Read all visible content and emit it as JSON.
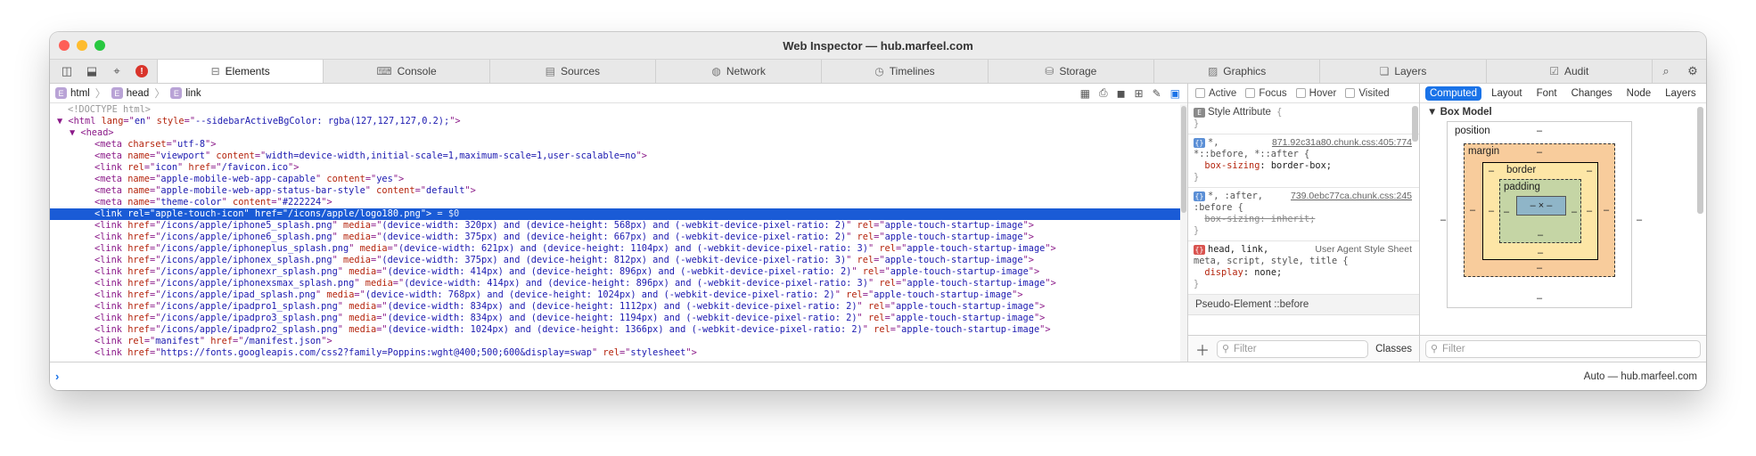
{
  "window": {
    "title": "Web Inspector — hub.marfeel.com"
  },
  "tabs": [
    {
      "label": "Elements",
      "icon": "elements-icon",
      "active": true
    },
    {
      "label": "Console",
      "icon": "console-icon"
    },
    {
      "label": "Sources",
      "icon": "document-icon"
    },
    {
      "label": "Network",
      "icon": "network-icon"
    },
    {
      "label": "Timelines",
      "icon": "clock-icon"
    },
    {
      "label": "Storage",
      "icon": "database-icon"
    },
    {
      "label": "Graphics",
      "icon": "image-icon"
    },
    {
      "label": "Layers",
      "icon": "layers-icon"
    },
    {
      "label": "Audit",
      "icon": "audit-icon"
    }
  ],
  "breadcrumb": [
    {
      "badge": "E",
      "label": "html"
    },
    {
      "badge": "E",
      "label": "head"
    },
    {
      "badge": "E",
      "label": "link"
    }
  ],
  "dom": {
    "doctype": "<!DOCTYPE html>",
    "html_line": [
      "▼ <",
      "html",
      " ",
      "lang",
      "=\"",
      "en",
      "\" ",
      "style",
      "=\"",
      "--sidebarActiveBgColor: rgba(127,127,127,0.2);",
      "\">"
    ],
    "head_line": "▼ <head>",
    "rows": [
      {
        "tag": "meta",
        "attrs": [
          [
            "charset",
            "utf-8"
          ]
        ]
      },
      {
        "tag": "meta",
        "attrs": [
          [
            "name",
            "viewport"
          ],
          [
            "content",
            "width=device-width,initial-scale=1,maximum-scale=1,user-scalable=no"
          ]
        ]
      },
      {
        "tag": "link",
        "attrs": [
          [
            "rel",
            "icon"
          ],
          [
            "href",
            "/favicon.ico"
          ]
        ]
      },
      {
        "tag": "meta",
        "attrs": [
          [
            "name",
            "apple-mobile-web-app-capable"
          ],
          [
            "content",
            "yes"
          ]
        ]
      },
      {
        "tag": "meta",
        "attrs": [
          [
            "name",
            "apple-mobile-web-app-status-bar-style"
          ],
          [
            "content",
            "default"
          ]
        ]
      },
      {
        "tag": "meta",
        "attrs": [
          [
            "name",
            "theme-color"
          ],
          [
            "content",
            "#222224"
          ]
        ]
      },
      {
        "tag": "link",
        "attrs": [
          [
            "rel",
            "apple-touch-icon"
          ],
          [
            "href",
            "/icons/apple/logo180.png"
          ]
        ],
        "selected": true,
        "suffix": " = $0"
      },
      {
        "tag": "link",
        "attrs": [
          [
            "href",
            "/icons/apple/iphone5_splash.png"
          ],
          [
            "media",
            "(device-width: 320px) and (device-height: 568px) and (-webkit-device-pixel-ratio: 2)"
          ],
          [
            "rel",
            "apple-touch-startup-image"
          ]
        ]
      },
      {
        "tag": "link",
        "attrs": [
          [
            "href",
            "/icons/apple/iphone6_splash.png"
          ],
          [
            "media",
            "(device-width: 375px) and (device-height: 667px) and (-webkit-device-pixel-ratio: 2)"
          ],
          [
            "rel",
            "apple-touch-startup-image"
          ]
        ]
      },
      {
        "tag": "link",
        "attrs": [
          [
            "href",
            "/icons/apple/iphoneplus_splash.png"
          ],
          [
            "media",
            "(device-width: 621px) and (device-height: 1104px) and (-webkit-device-pixel-ratio: 3)"
          ],
          [
            "rel",
            "apple-touch-startup-image"
          ]
        ]
      },
      {
        "tag": "link",
        "attrs": [
          [
            "href",
            "/icons/apple/iphonex_splash.png"
          ],
          [
            "media",
            "(device-width: 375px) and (device-height: 812px) and (-webkit-device-pixel-ratio: 3)"
          ],
          [
            "rel",
            "apple-touch-startup-image"
          ]
        ]
      },
      {
        "tag": "link",
        "attrs": [
          [
            "href",
            "/icons/apple/iphonexr_splash.png"
          ],
          [
            "media",
            "(device-width: 414px) and (device-height: 896px) and (-webkit-device-pixel-ratio: 2)"
          ],
          [
            "rel",
            "apple-touch-startup-image"
          ]
        ]
      },
      {
        "tag": "link",
        "attrs": [
          [
            "href",
            "/icons/apple/iphonexsmax_splash.png"
          ],
          [
            "media",
            "(device-width: 414px) and (device-height: 896px) and (-webkit-device-pixel-ratio: 3)"
          ],
          [
            "rel",
            "apple-touch-startup-image"
          ]
        ]
      },
      {
        "tag": "link",
        "attrs": [
          [
            "href",
            "/icons/apple/ipad_splash.png"
          ],
          [
            "media",
            "(device-width: 768px) and (device-height: 1024px) and (-webkit-device-pixel-ratio: 2)"
          ],
          [
            "rel",
            "apple-touch-startup-image"
          ]
        ]
      },
      {
        "tag": "link",
        "attrs": [
          [
            "href",
            "/icons/apple/ipadpro1_splash.png"
          ],
          [
            "media",
            "(device-width: 834px) and (device-height: 1112px) and (-webkit-device-pixel-ratio: 2)"
          ],
          [
            "rel",
            "apple-touch-startup-image"
          ]
        ]
      },
      {
        "tag": "link",
        "attrs": [
          [
            "href",
            "/icons/apple/ipadpro3_splash.png"
          ],
          [
            "media",
            "(device-width: 834px) and (device-height: 1194px) and (-webkit-device-pixel-ratio: 2)"
          ],
          [
            "rel",
            "apple-touch-startup-image"
          ]
        ]
      },
      {
        "tag": "link",
        "attrs": [
          [
            "href",
            "/icons/apple/ipadpro2_splash.png"
          ],
          [
            "media",
            "(device-width: 1024px) and (device-height: 1366px) and (-webkit-device-pixel-ratio: 2)"
          ],
          [
            "rel",
            "apple-touch-startup-image"
          ]
        ]
      },
      {
        "tag": "link",
        "attrs": [
          [
            "rel",
            "manifest"
          ],
          [
            "href",
            "/manifest.json"
          ]
        ]
      },
      {
        "tag": "link",
        "attrs": [
          [
            "href",
            "https://fonts.googleapis.com/css2?family=Poppins:wght@400;500;600&display=swap"
          ],
          [
            "rel",
            "stylesheet"
          ]
        ]
      }
    ]
  },
  "pseudo_states": [
    "Active",
    "Focus",
    "Hover",
    "Visited"
  ],
  "styles": {
    "style_attribute": "Style Attribute",
    "rule1_selector": "*,",
    "rule1_selector2": "*::before, *::after {",
    "rule1_source": "871.92c31a80.chunk.css:405:774",
    "rule1_prop": "box-sizing",
    "rule1_val": "border-box;",
    "rule2_selector": "*, :after,",
    "rule2_selector2": ":before {",
    "rule2_source": "739.0ebc77ca.chunk.css:245",
    "rule2_decl": "box-sizing: inherit;",
    "rule3_selector": "head, link,",
    "rule3_selector2": "meta, script, style, title {",
    "rule3_source": "User Agent Style Sheet",
    "rule3_prop": "display",
    "rule3_val": "none;",
    "pseudo_element": "Pseudo-Element ::before",
    "filter_placeholder": "Filter",
    "classes_label": "Classes"
  },
  "sidebar_tabs": [
    "Computed",
    "Layout",
    "Font",
    "Changes",
    "Node",
    "Layers"
  ],
  "box_model": {
    "title": "Box Model",
    "position": "position",
    "margin": "margin",
    "border": "border",
    "padding": "padding",
    "content": "– × –",
    "dash": "–"
  },
  "right_filter_placeholder": "Filter",
  "console": {
    "prompt": "›",
    "context": "Auto — hub.marfeel.com"
  }
}
